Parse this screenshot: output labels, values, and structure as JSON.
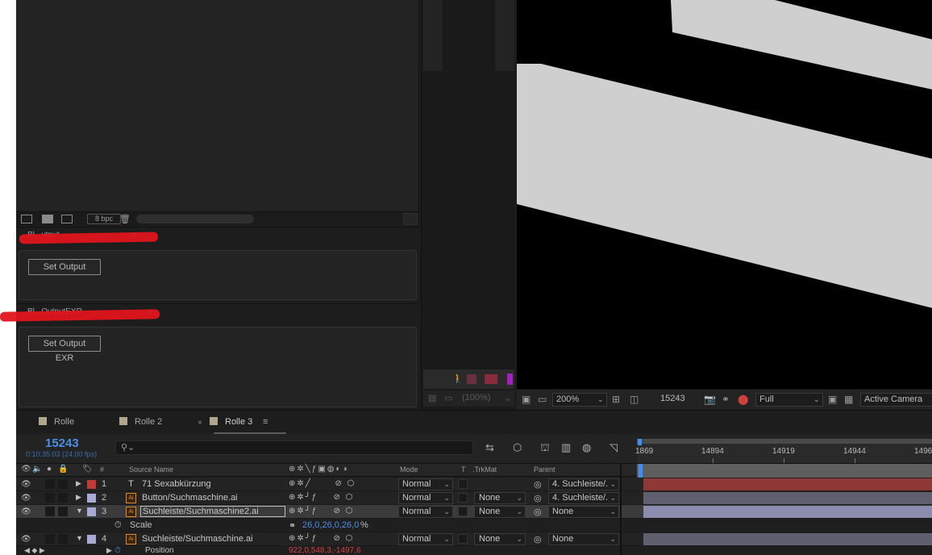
{
  "project": {
    "bpc_label": "8 bpc"
  },
  "panels": {
    "output": {
      "title": "Bl...utput",
      "button": "Set Output",
      "menu": "≡"
    },
    "exr": {
      "title": "Bl...OutputEXR",
      "button": "Set Output EXR",
      "menu": "≡"
    }
  },
  "middle": {
    "zoom_label": "(100%)"
  },
  "viewer": {
    "zoom": "200%",
    "frame": "15243",
    "resolution": "Full",
    "camera": "Active Camera"
  },
  "tabs": [
    {
      "label": "Rolle",
      "color": "#b1a58d"
    },
    {
      "label": "Rolle 2",
      "color": "#b1a58d"
    },
    {
      "label": "Rolle 3",
      "color": "#b1a58d",
      "active": true
    }
  ],
  "tabs_menu": "≡",
  "timeline": {
    "timecode": "15243",
    "timecode_sub": "0:10:35:03 (24.00 fps)",
    "ruler": [
      "1869",
      "14894",
      "14919",
      "14944",
      "1496"
    ]
  },
  "columns": {
    "num": "#",
    "source_name": "Source Name",
    "mode": "Mode",
    "t": "T",
    "trkmat": ".TrkMat",
    "parent": "Parent"
  },
  "layers": [
    {
      "num": "1",
      "name": "71 Sexabkürzung",
      "type": "T",
      "label_color": "#c03a3a",
      "mode": "Normal",
      "trkmat": "",
      "parent": "4. Suchleiste/.",
      "bar_color": "#8e3838",
      "expanded": false
    },
    {
      "num": "2",
      "name": "Button/Suchmaschine.ai",
      "type": "Ai",
      "label_color": "#a9a9d8",
      "mode": "Normal",
      "trkmat": "None",
      "parent": "4. Suchleiste/.",
      "bar_color": "#5f5f70",
      "expanded": false
    },
    {
      "num": "3",
      "name": "Suchleiste/Suchmaschine2.ai",
      "type": "Ai",
      "label_color": "#a9a9d8",
      "mode": "Normal",
      "trkmat": "None",
      "parent": "None",
      "bar_color": "#8c8cae",
      "expanded": true,
      "selected": true
    },
    {
      "num": "4",
      "name": "Suchleiste/Suchmaschine.ai",
      "type": "Ai",
      "label_color": "#a9a9d8",
      "mode": "Normal",
      "trkmat": "None",
      "parent": "None",
      "bar_color": "#5f5f70",
      "expanded": true
    }
  ],
  "scale_prop": {
    "label": "Scale",
    "value": "26,0,26,0,26,0",
    "unit": "%"
  },
  "position_prop": {
    "label": "Position",
    "value": "922,0,548,3,-1497,6"
  }
}
